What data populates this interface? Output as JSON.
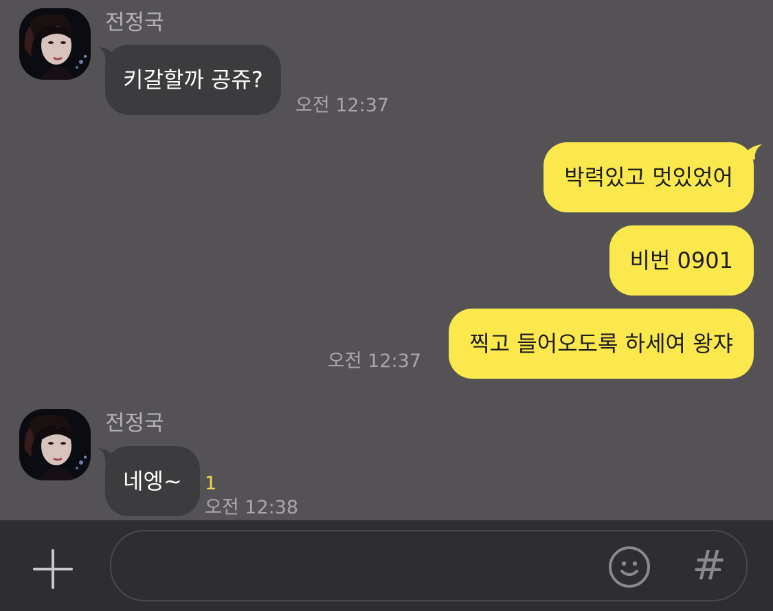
{
  "messages": [
    {
      "sender": "전정국",
      "text": "키갈할까 공쥬?",
      "time": "오전 12:37"
    },
    {
      "outgoing": [
        {
          "text": "박력있고 멋있었어"
        },
        {
          "text": "비번 0901"
        },
        {
          "text": "찍고 들어오도록 하세여 왕쟈"
        }
      ],
      "time": "오전 12:37"
    },
    {
      "sender": "전정국",
      "text": "네엥~",
      "unread_count": "1",
      "time": "오전 12:38"
    }
  ],
  "input_bar": {
    "placeholder": "",
    "plus_icon": "plus-icon",
    "emoji_icon": "smiley-icon",
    "hash_label": "#"
  },
  "colors": {
    "background": "#545255",
    "incoming_bubble": "#3c3b3e",
    "outgoing_bubble": "#fae84c",
    "unread_badge": "#f4dd4a",
    "input_bar": "#2e2d30"
  }
}
